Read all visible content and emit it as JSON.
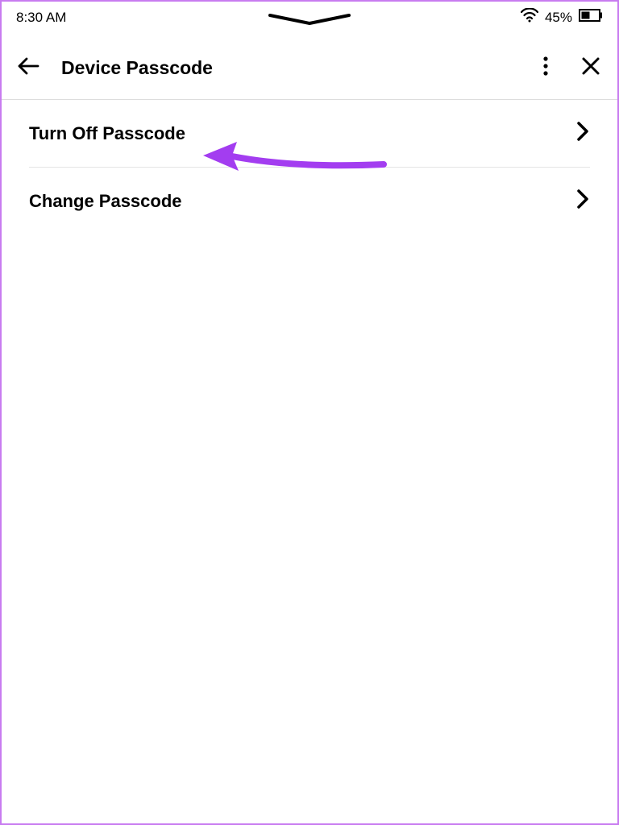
{
  "status": {
    "time": "8:30 AM",
    "battery_pct": "45%"
  },
  "header": {
    "title": "Device Passcode"
  },
  "list": {
    "items": [
      {
        "label": "Turn Off Passcode"
      },
      {
        "label": "Change Passcode"
      }
    ]
  },
  "annotation": {
    "color": "#a33df0"
  }
}
